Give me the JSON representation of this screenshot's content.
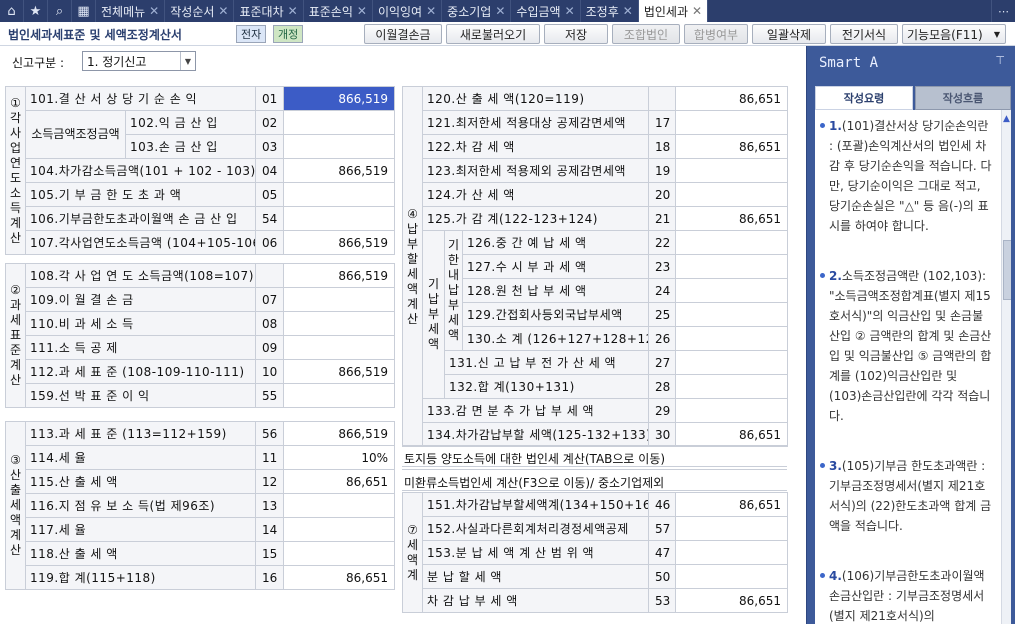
{
  "tabs": [
    {
      "label": "전체메뉴"
    },
    {
      "label": "작성순서"
    },
    {
      "label": "표준대차"
    },
    {
      "label": "표준손익"
    },
    {
      "label": "이익잉여"
    },
    {
      "label": "중소기업"
    },
    {
      "label": "수입금액"
    },
    {
      "label": "조정후"
    },
    {
      "label": "법인세과"
    }
  ],
  "title": "법인세과세표준 및 세액조정계산서",
  "badges": {
    "jeonja": "전자",
    "gaejung": "개정"
  },
  "buttons": {
    "b1": "이월결손금",
    "b2": "새로불러오기",
    "b3": "저장",
    "b4": "조합법인",
    "b5": "합병여부",
    "b6": "일괄삭제",
    "b7": "전기서식",
    "b8": "기능모음(F11)"
  },
  "filter": {
    "label": "신고구분 :",
    "value": "1. 정기신고"
  },
  "s1": {
    "title": "① 각사업연도소득계산",
    "sub": "소득금액조정금액",
    "r101": [
      "101.결 산 서 상 당 기 순 손 익",
      "01",
      "866,519"
    ],
    "r102": [
      "102.익 금 산 입",
      "02",
      ""
    ],
    "r103": [
      "103.손 금 산 입",
      "03",
      ""
    ],
    "r104": [
      "104.차가감소득금액(101 + 102 - 103)",
      "04",
      "866,519"
    ],
    "r105": [
      "105.기 부 금 한 도 초 과 액",
      "05",
      ""
    ],
    "r106": [
      "106.기부금한도초과이월액 손 금 산 입",
      "54",
      ""
    ],
    "r107": [
      "107.각사업연도소득금액 (104+105-106)",
      "06",
      "866,519"
    ]
  },
  "s2": {
    "title": "② 과세표준계산",
    "r108": [
      "108.각 사 업 연 도 소득금액(108=107)",
      "",
      "866,519"
    ],
    "r109": [
      "109.이 월 결 손 금",
      "07",
      ""
    ],
    "r110": [
      "110.비 과 세 소 득",
      "08",
      ""
    ],
    "r111": [
      "111.소 득 공 제",
      "09",
      ""
    ],
    "r112": [
      "112.과 세 표 준 (108-109-110-111)",
      "10",
      "866,519"
    ],
    "r159": [
      "159.선 박 표 준 이 익",
      "55",
      ""
    ]
  },
  "s3": {
    "title": "③ 산출세액계산",
    "r113": [
      "113.과 세 표 준 (113=112+159)",
      "56",
      "866,519"
    ],
    "r114": [
      "114.세 율",
      "11",
      "10%"
    ],
    "r115": [
      "115.산 출 세 액",
      "12",
      "86,651"
    ],
    "r116": [
      "116.지 점 유 보 소 득(법 제96조)",
      "13",
      ""
    ],
    "r117": [
      "117.세 율",
      "14",
      ""
    ],
    "r118": [
      "118.산 출 세 액",
      "15",
      ""
    ],
    "r119": [
      "119.합 계(115+118)",
      "16",
      "86,651"
    ]
  },
  "s4": {
    "title": "④ 납부할세액계산",
    "sub1": "기납부세액",
    "sub2": "기한내납부세액",
    "r120": [
      "120.산 출 세 액(120=119)",
      "",
      "86,651"
    ],
    "r121": [
      "121.최저한세 적용대상 공제감면세액",
      "17",
      ""
    ],
    "r122": [
      "122.차 감 세 액",
      "18",
      "86,651"
    ],
    "r123": [
      "123.최저한세 적용제외 공제감면세액",
      "19",
      ""
    ],
    "r124": [
      "124.가 산 세 액",
      "20",
      ""
    ],
    "r125": [
      "125.가 감 계(122-123+124)",
      "21",
      "86,651"
    ],
    "r126": [
      "126.중 간 예 납 세 액",
      "22",
      ""
    ],
    "r127": [
      "127.수 시 부 과 세 액",
      "23",
      ""
    ],
    "r128": [
      "128.원 천 납 부 세 액",
      "24",
      ""
    ],
    "r129": [
      "129.간접회사등외국납부세액",
      "25",
      ""
    ],
    "r130": [
      "130.소 계 (126+127+128+129)",
      "26",
      ""
    ],
    "r131": [
      "131.신 고 납 부 전 가 산 세 액",
      "27",
      ""
    ],
    "r132": [
      "132.합 계(130+131)",
      "28",
      ""
    ],
    "r133": [
      "133.감 면 분 추 가 납 부 세 액",
      "29",
      ""
    ],
    "r134": [
      "134.차가감납부할 세액(125-132+133)",
      "30",
      "86,651"
    ]
  },
  "notes": {
    "n1": "토지등 양도소득에 대한 법인세 계산(TAB으로 이동)",
    "n2": "미환류소득법인세 계산(F3으로 이동)/ 중소기업제외"
  },
  "s7": {
    "title": "⑦ 세액계",
    "r151": [
      "151.차가감납부할세액계(134+150+166)",
      "46",
      "86,651"
    ],
    "r152": [
      "152.사실과다른회계처리경정세액공제",
      "57",
      ""
    ],
    "r153": [
      "153.분 납 세 액 계 산 범 위 액",
      "47",
      ""
    ],
    "rbun": [
      "분 납 할 세 액",
      "50",
      ""
    ],
    "rcha": [
      "차 감 납 부 세 액",
      "53",
      "86,651"
    ]
  },
  "smart": {
    "title": "Smart A",
    "tab1": "작성요령",
    "tab2": "작성흐름",
    "i1n": "1.",
    "i1": "(101)결산서상 당기순손익란 : (포괄)손익계산서의 법인세 차감 후 당기순손익을 적습니다. 다만, 당기순이익은 그대로 적고, 당기순손실은 \"△\" 등 음(-)의 표시를 하여야 합니다.",
    "i2n": "2.",
    "i2": "소득조정금액란 (102,103): \"소득금액조정합계표(별지 제15호서식)\"의 익금산입 및 손금불산입 ② 금액란의 합계 및 손금산입 및 익금불산입 ⑤ 금액란의 합계를 (102)익금산입란 및 (103)손금산입란에 각각 적습니다.",
    "i3n": "3.",
    "i3": "(105)기부금 한도초과액란 : 기부금조정명세서(별지 제21호서식)의 (22)한도초과액 합계 금액을 적습니다.",
    "i4n": "4.",
    "i4": "(106)기부금한도초과이월액 손금산입란 : 기부금조정명세서(별지 제21호서식)의"
  }
}
